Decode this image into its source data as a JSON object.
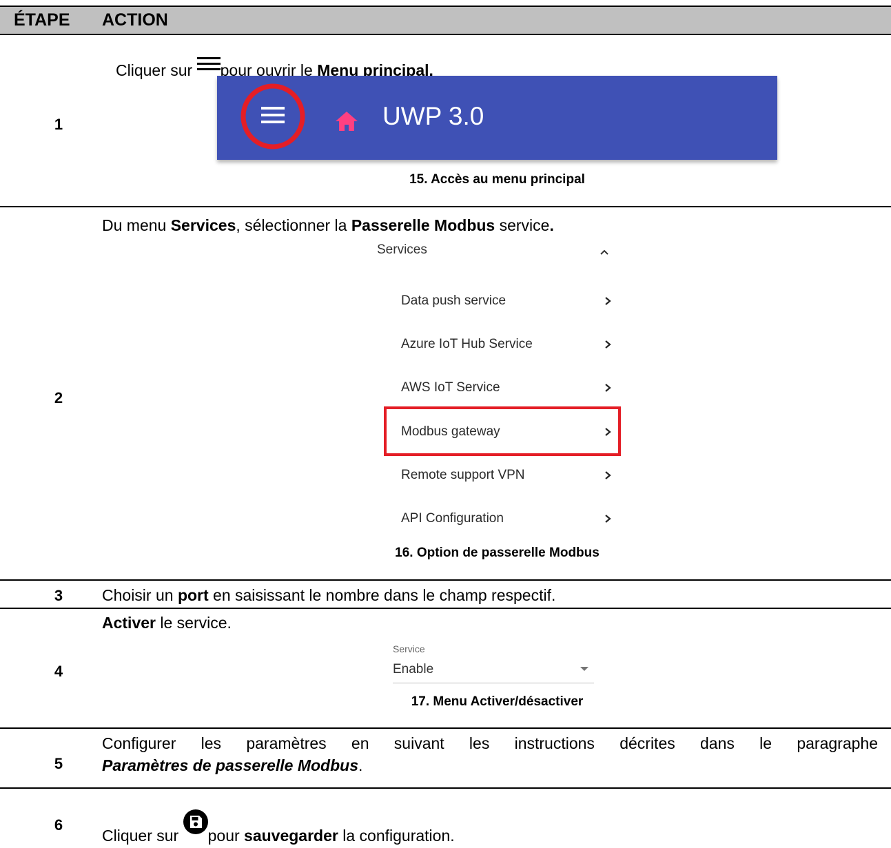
{
  "header": {
    "col_step": "ÉTAPE",
    "col_action": "ACTION"
  },
  "steps": [
    {
      "num": "1",
      "text_pre": "Cliquer sur ",
      "icon": "hamburger-menu-icon",
      "text_mid": "pour ouvrir le ",
      "text_bold": "Menu principal.",
      "figure": {
        "title": "UWP 3.0",
        "bar_color": "#3f51b5",
        "home_icon_color": "#ff4081",
        "circle_color": "#e41e26"
      },
      "caption": "15.  Accès au menu principal"
    },
    {
      "num": "2",
      "text_pre": "Du menu ",
      "text_bold1": "Services",
      "text_mid": ", sélectionner la ",
      "text_bold2": "Passerelle Modbus",
      "text_post": " service",
      "text_end": ".",
      "menu": {
        "title": "Services",
        "items": [
          "Data push service",
          "Azure IoT Hub Service",
          "AWS IoT Service",
          "Modbus gateway",
          "Remote support VPN",
          "API Configuration"
        ],
        "highlight_color": "#e41e26"
      },
      "caption": "16.  Option de passerelle Modbus"
    },
    {
      "num": "3",
      "text_pre": "Choisir un ",
      "text_bold": "port",
      "text_post": " en saisissant le nombre dans le champ respectif."
    },
    {
      "num": "4",
      "text_bold": "Activer",
      "text_post": " le service.",
      "dropdown": {
        "label": "Service",
        "value": "Enable"
      },
      "caption": "17.  Menu Activer/désactiver"
    },
    {
      "num": "5",
      "text_line1": "Configurer les paramètres en suivant les instructions décrites dans le paragraphe",
      "text_bold_italic": "Paramètres de passerelle Modbus",
      "text_end": "."
    },
    {
      "num": "6",
      "text_pre": "Cliquer sur ",
      "icon": "save-icon",
      "text_mid": "pour ",
      "text_bold": "sauvegarder",
      "text_post": " la configuration."
    }
  ]
}
